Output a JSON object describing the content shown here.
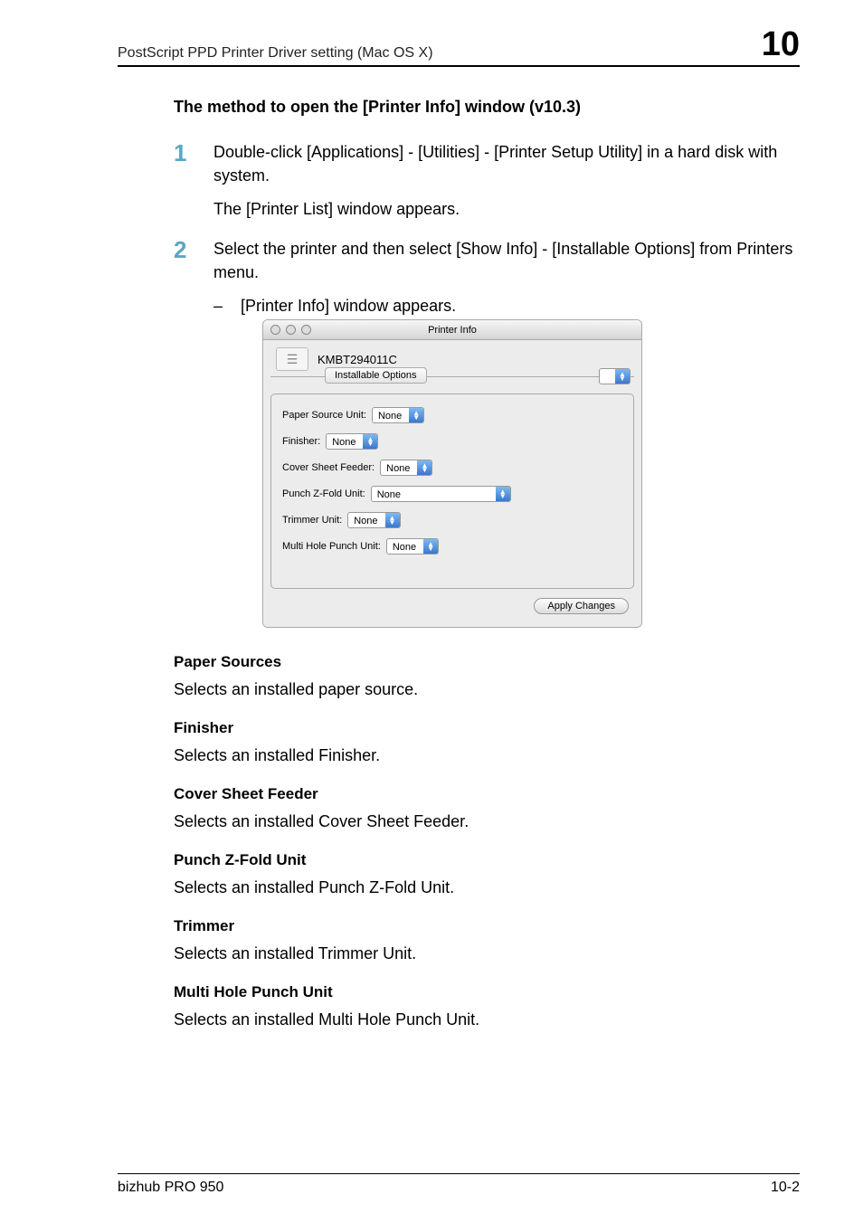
{
  "header": {
    "left": "PostScript PPD Printer Driver setting (Mac OS X)",
    "right": "10"
  },
  "subtitle": "The method to open the [Printer Info] window (v10.3)",
  "steps": [
    {
      "num": "1",
      "text": "Double-click [Applications] - [Utilities] - [Printer Setup Utility] in a hard disk with system.",
      "follow": "The [Printer List] window appears."
    },
    {
      "num": "2",
      "text": "Select the printer and then select [Show Info] - [Installable Options] from Printers menu.",
      "bullet": "[Printer Info] window appears."
    }
  ],
  "dialog": {
    "title": "Printer Info",
    "printer_name": "KMBT294011C",
    "tab": "Installable Options",
    "options": [
      {
        "label": "Paper Source Unit:",
        "value": "None"
      },
      {
        "label": "Finisher:",
        "value": "None"
      },
      {
        "label": "Cover Sheet Feeder:",
        "value": "None"
      },
      {
        "label": "Punch Z-Fold Unit:",
        "value": "None"
      },
      {
        "label": "Trimmer Unit:",
        "value": "None"
      },
      {
        "label": "Multi Hole Punch Unit:",
        "value": "None"
      }
    ],
    "apply": "Apply Changes"
  },
  "sections": [
    {
      "head": "Paper Sources",
      "body": "Selects an installed paper source."
    },
    {
      "head": "Finisher",
      "body": "Selects an installed Finisher."
    },
    {
      "head": "Cover Sheet Feeder",
      "body": "Selects an installed Cover Sheet Feeder."
    },
    {
      "head": "Punch Z-Fold Unit",
      "body": "Selects an installed Punch Z-Fold Unit."
    },
    {
      "head": "Trimmer",
      "body": "Selects an installed Trimmer Unit."
    },
    {
      "head": "Multi Hole Punch Unit",
      "body": "Selects an installed Multi Hole Punch Unit."
    }
  ],
  "footer": {
    "left": "bizhub PRO 950",
    "right": "10-2"
  }
}
